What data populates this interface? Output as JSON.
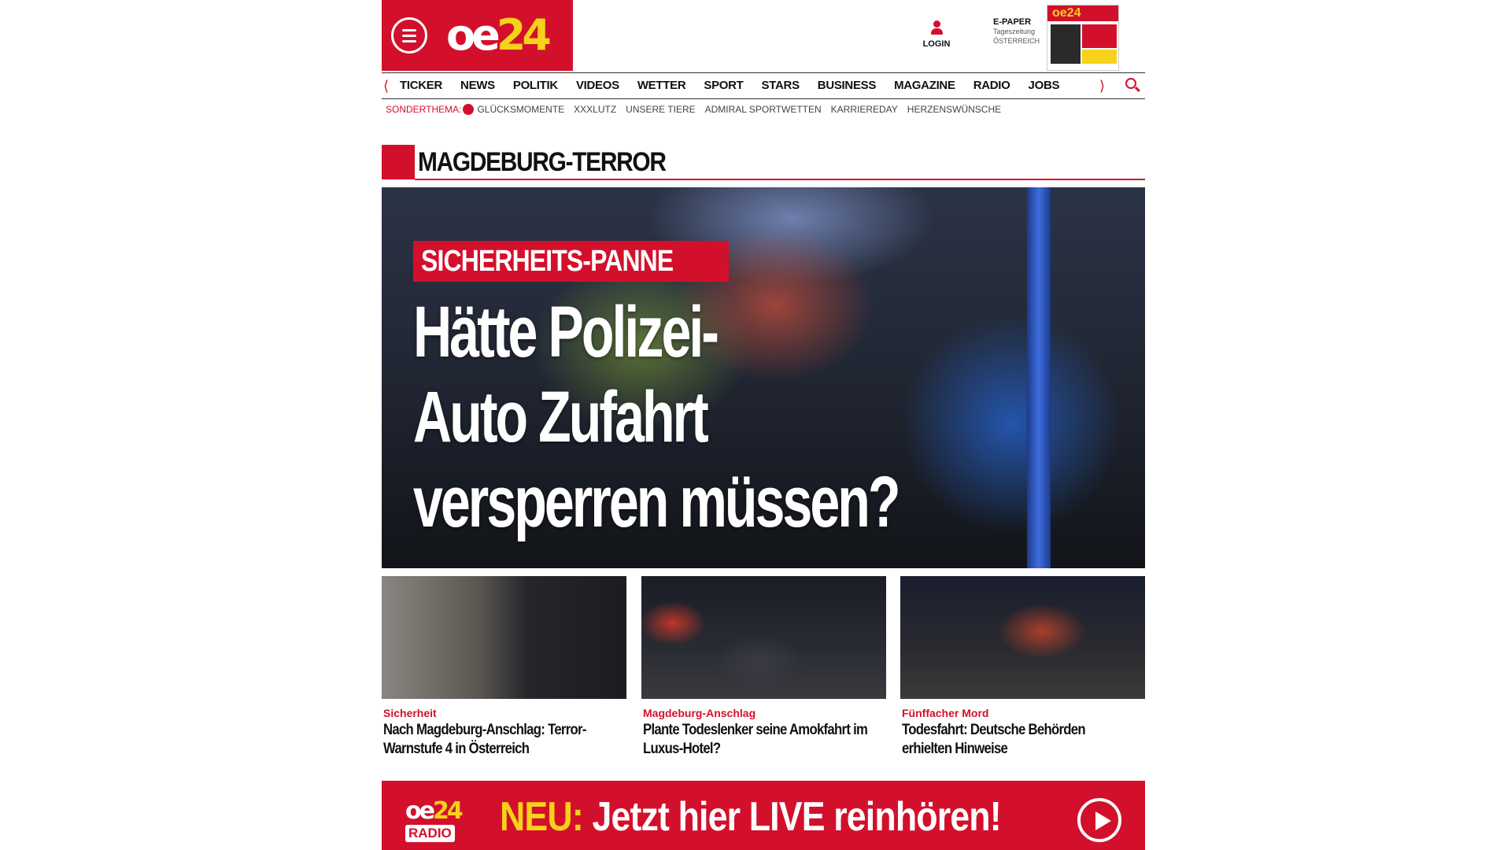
{
  "header": {
    "logo": {
      "oe": "oe",
      "num": "24"
    },
    "login_label": "LOGIN",
    "epaper": {
      "title": "E-PAPER",
      "sub1": "Tageszeitung",
      "sub2": "ÖSTERREICH"
    },
    "cover_logo": "oe24"
  },
  "nav": {
    "items": [
      "TICKER",
      "NEWS",
      "POLITIK",
      "VIDEOS",
      "WETTER",
      "SPORT",
      "STARS",
      "BUSINESS",
      "MAGAZINE",
      "RADIO",
      "JOBS"
    ]
  },
  "subnav": {
    "label": "SONDERTHEMA:",
    "items": [
      "GLÜCKSMOMENTE",
      "XXXLUTZ",
      "UNSERE TIERE",
      "ADMIRAL SPORTWETTEN",
      "KARRIEREDAY",
      "HERZENSWÜNSCHE"
    ]
  },
  "section": {
    "title": "MAGDEBURG-TERROR"
  },
  "hero": {
    "kicker": "SICHERHEITS-PANNE",
    "title_line1": "Hätte Polizei-",
    "title_line2": "Auto Zufahrt",
    "title_line3": "versperren müssen?"
  },
  "teasers": [
    {
      "category": "Sicherheit",
      "title": "Nach Magdeburg-Anschlag: Terror-Warnstufe 4 in Österreich"
    },
    {
      "category": "Magdeburg-Anschlag",
      "title": "Plante Todeslenker seine Amokfahrt im Luxus-Hotel?"
    },
    {
      "category": "Fünffacher Mord",
      "title": "Todesfahrt: Deutsche Behörden erhielten Hinweise"
    }
  ],
  "banner": {
    "logo_top_a": "oe",
    "logo_top_b": "24",
    "logo_bottom": "RADIO",
    "neu": "NEU:",
    "text": " Jetzt hier LIVE reinhören!"
  },
  "colors": {
    "brand_red": "#d3102c",
    "brand_yellow": "#f6d21a"
  }
}
